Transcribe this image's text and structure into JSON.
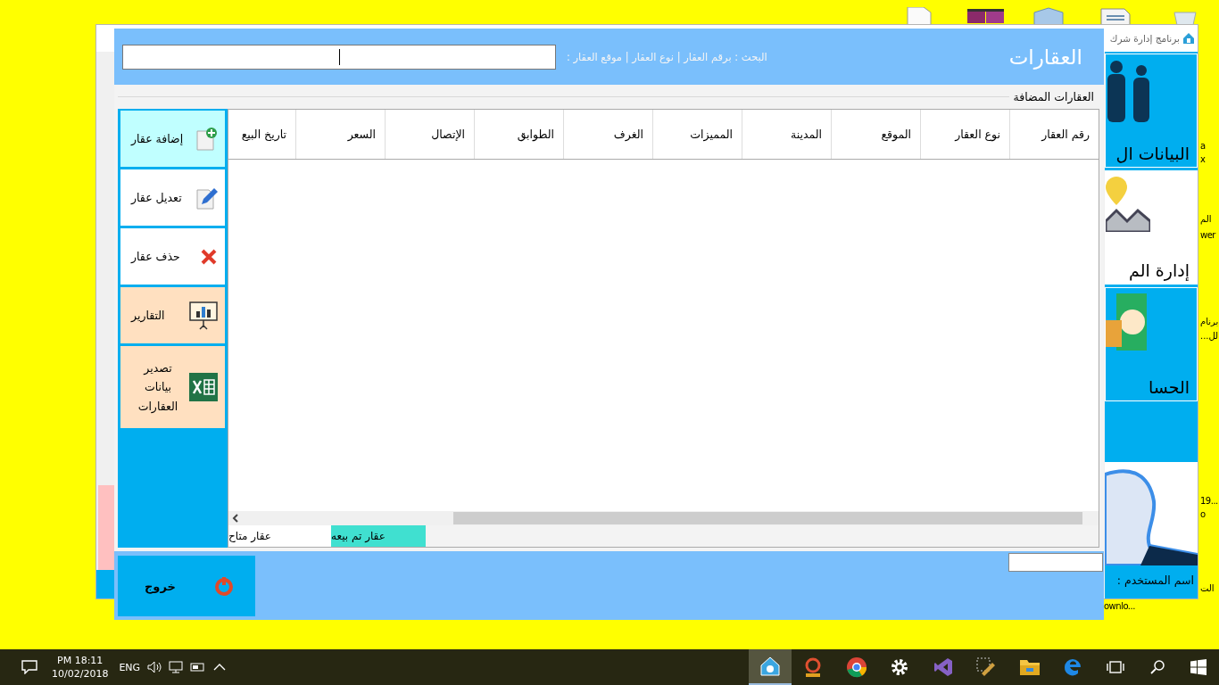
{
  "desktop": {
    "edge_labels": [
      "a",
      "x",
      "الم",
      "wer",
      "برنام",
      "...لل",
      "19...",
      "o",
      "الت",
      "ownlo..."
    ]
  },
  "background_window": {
    "title": "برنامج إدارة شرك",
    "tiles": [
      {
        "label": "البيانات ال",
        "kind": "people",
        "color": "#00aeef"
      },
      {
        "label": "إدارة الم",
        "kind": "houses",
        "color": "#ffffff"
      },
      {
        "label": "الحسا",
        "kind": "money",
        "color": "#00aeef"
      }
    ],
    "user_label": "اسم المستخدم :"
  },
  "dialog": {
    "title": "العقارات",
    "search": {
      "label": "البحث : برقم العقار | نوع العقار | موقع العقار :"
    },
    "group_title": "العقارات المضافة",
    "actions": [
      {
        "label": "إضافة عقار",
        "kind": "add",
        "color": "#c0ffff"
      },
      {
        "label": "تعديل عقار",
        "kind": "edit",
        "color": "#ffffff"
      },
      {
        "label": "حذف عقار",
        "kind": "delete",
        "color": "#ffffff"
      },
      {
        "label": "التقارير",
        "kind": "report",
        "color": "#ffe0c0"
      },
      {
        "label": "تصدير بيانات العقارات",
        "kind": "excel",
        "color": "#ffe0c0"
      }
    ],
    "table": {
      "columns": [
        "رقم العقار",
        "نوع العقار",
        "الموقع",
        "المدينة",
        "المميزات",
        "الغرف",
        "الطوابق",
        "الإتصال",
        "السعر",
        "تاريخ البيع"
      ]
    },
    "legend": [
      {
        "label": "عقار تم بيعه",
        "color": "#40e0d0"
      },
      {
        "label": "عقار متاح",
        "color": "#ffffff"
      }
    ],
    "exit_button": "خروج"
  },
  "taskbar": {
    "time": "PM 18:11",
    "date": "10/02/2018",
    "language": "ENG",
    "apps": [
      {
        "kind": "home",
        "selected": true
      },
      {
        "kind": "gears",
        "selected": false
      },
      {
        "kind": "chrome",
        "selected": false
      },
      {
        "kind": "settings",
        "selected": false
      },
      {
        "kind": "studio",
        "selected": false
      },
      {
        "kind": "tools",
        "selected": false
      },
      {
        "kind": "folder",
        "selected": false
      },
      {
        "kind": "edge",
        "selected": false
      }
    ]
  }
}
